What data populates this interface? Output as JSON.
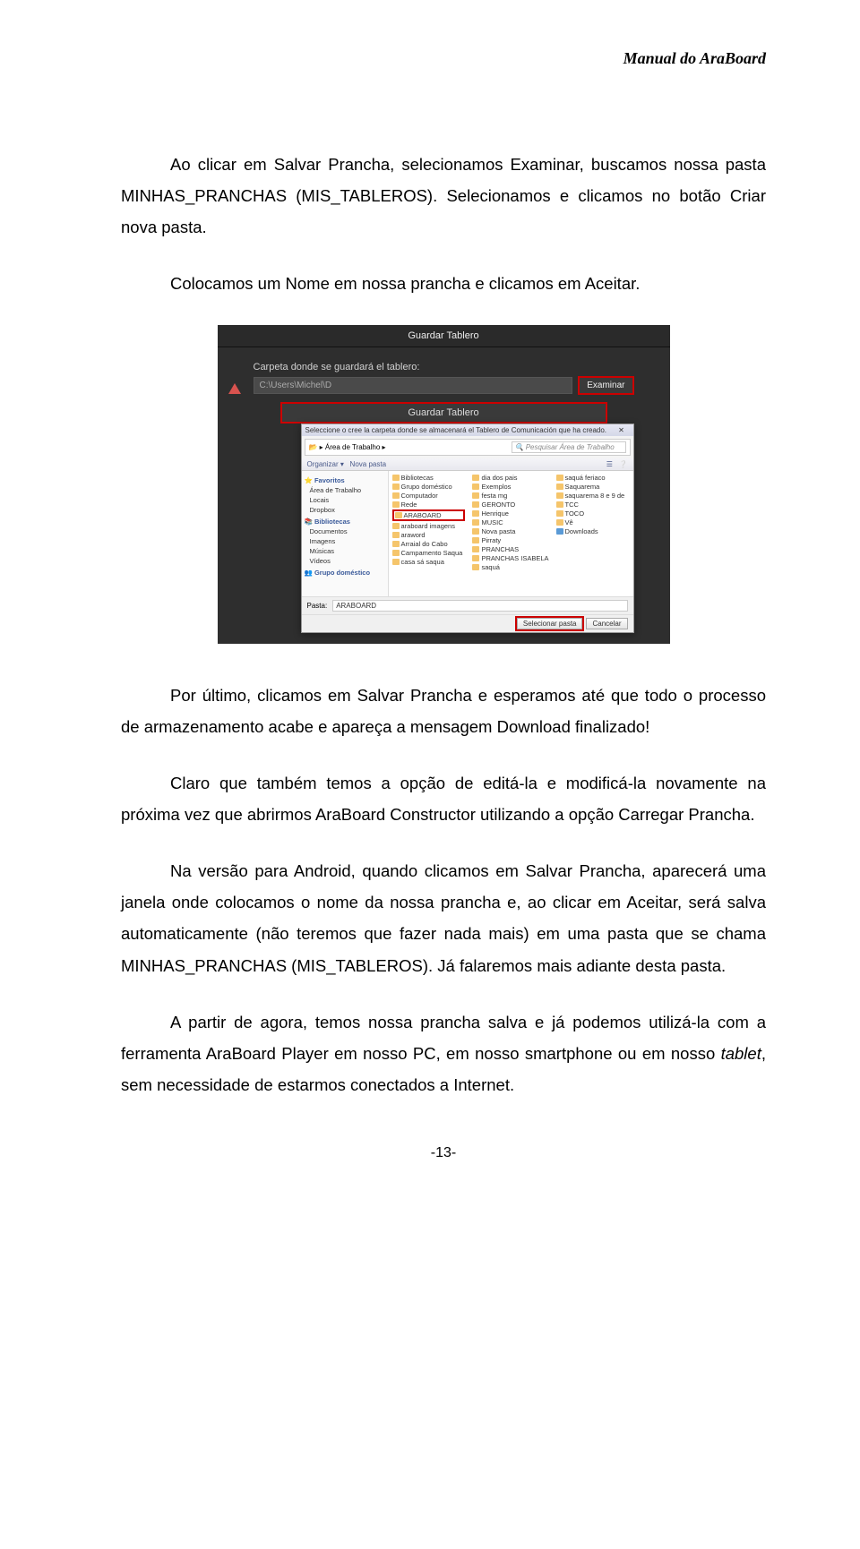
{
  "header": "Manual do AraBoard",
  "p1": "Ao clicar em Salvar Prancha, selecionamos Examinar, buscamos nossa pasta MINHAS_PRANCHAS (MIS_TABLEROS). Selecionamos e clicamos no botão Criar nova pasta.",
  "p2": "Colocamos um Nome em nossa prancha e clicamos em Aceitar.",
  "p3": "Por último, clicamos em Salvar Prancha e esperamos até que todo o processo de armazenamento acabe e apareça a mensagem Download finalizado!",
  "p4": "Claro que também temos a opção de editá-la e modificá-la novamente na próxima vez que abrirmos AraBoard Constructor utilizando a opção Carregar Prancha.",
  "p5_a": "Na versão para Android, quando clicamos em Salvar Prancha, aparecerá uma janela onde colocamos o nome da nossa prancha e, ao clicar em Aceitar, será salva automaticamente (não teremos que fazer nada mais) em uma pasta que se chama MINHAS_PRANCHAS (MIS_TABLEROS). Já falaremos mais adiante desta pasta.",
  "p6_a": "A partir de agora, temos nossa prancha salva e já podemos utilizá-la com a ferramenta AraBoard Player em nosso PC, em nosso smartphone ou em nosso ",
  "p6_b": "tablet",
  "p6_c": ", sem necessidade de estarmos conectados a Internet.",
  "page_num": "-13-",
  "shot": {
    "app_title": "Guardar Tablero",
    "carpeta_label": "Carpeta donde se guardará el tablero:",
    "path_value": "C:\\Users\\Michel\\D",
    "examinar": "Examinar",
    "guardar_bar": "Guardar Tablero",
    "dlg_title": "Seleccione o cree la carpeta donde se almacenará el Tablero de Comunicación que ha creado.",
    "crumb_area": "Área de Trabalho",
    "search_ph": "Pesquisar Área de Trabalho",
    "tool_org": "Organizar ▾",
    "tool_new": "Nova pasta",
    "side": {
      "fav": "Favoritos",
      "fav_items": [
        "Área de Trabalho",
        "Locais",
        "Dropbox"
      ],
      "bib": "Bibliotecas",
      "bib_items": [
        "Documentos",
        "Imagens",
        "Músicas",
        "Vídeos"
      ],
      "grp": "Grupo doméstico"
    },
    "col1": [
      "Bibliotecas",
      "Grupo doméstico",
      "Computador",
      "Rede",
      "ARABOARD",
      "araboard imagens",
      "araword",
      "Arraial do Cabo",
      "Campamento Saqua",
      "casa sá saqua"
    ],
    "col2": [
      "dia dos pais",
      "Exemplos",
      "festa mg",
      "GERONTO",
      "Henrique",
      "MUSIC",
      "Nova pasta",
      "Pirraty",
      "PRANCHAS",
      "PRANCHAS ISABELA",
      "saquá"
    ],
    "col3": [
      "saquá feriaco",
      "Saquarema",
      "saquarema 8 e 9 de",
      "TCC",
      "TOCO",
      "Vê",
      "Downloads"
    ],
    "pasta_label": "Pasta:",
    "pasta_value": "ARABOARD",
    "btn_select": "Selecionar pasta",
    "btn_cancel": "Cancelar"
  }
}
